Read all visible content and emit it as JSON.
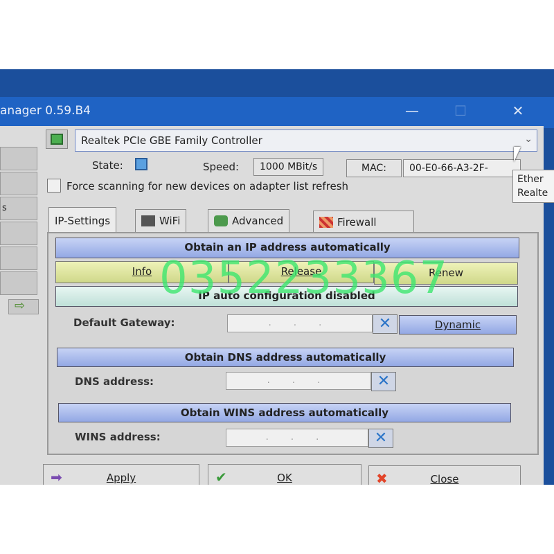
{
  "window": {
    "title": "anager 0.59.B4",
    "minimize": "—",
    "maximize": "☐",
    "close": "✕"
  },
  "sidebar": {
    "items": [
      "",
      "",
      "s",
      "",
      "",
      ""
    ],
    "arrow": "⇨"
  },
  "adapter": {
    "selected": "Realtek PCIe GBE Family Controller",
    "dropdown": "⌄"
  },
  "status": {
    "state_label": "State:",
    "speed_label": "Speed:",
    "speed_value": "1000 MBit/s",
    "mac_label": "MAC:",
    "mac_value": "00-E0-66-A3-2F-"
  },
  "tooltip": {
    "line1": "Ether",
    "line2": "Realte"
  },
  "force_scan": {
    "label": "Force scanning for new devices on adapter list refresh",
    "checked": false
  },
  "tabs": [
    {
      "label": "IP-Settings"
    },
    {
      "label": "WiFi"
    },
    {
      "label": "Advanced"
    },
    {
      "label": "Firewall"
    }
  ],
  "ip": {
    "obtain_ip": "Obtain an IP address automatically",
    "info": "Info",
    "release": "Release",
    "renew": "Renew",
    "auto_config": "IP auto configuration disabled",
    "gateway_label": "Default Gateway:",
    "gateway_value": ". . .",
    "dynamic": "Dynamic",
    "obtain_dns": "Obtain DNS address automatically",
    "dns_label": "DNS address:",
    "dns_value": ". . .",
    "obtain_wins": "Obtain WINS address automatically",
    "wins_label": "WINS address:",
    "wins_value": ". . ."
  },
  "footer": {
    "apply": "Apply",
    "ok": "OK",
    "close": "Close"
  },
  "watermark": "0352233367"
}
